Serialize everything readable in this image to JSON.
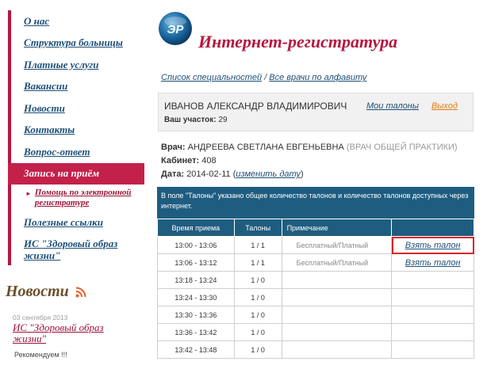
{
  "sidebar": {
    "items": [
      {
        "label": "О нас"
      },
      {
        "label": "Структура больницы"
      },
      {
        "label": "Платные услуги"
      },
      {
        "label": "Вакансии"
      },
      {
        "label": "Новости"
      },
      {
        "label": "Контакты"
      },
      {
        "label": "Вопрос-ответ"
      },
      {
        "label": "Запись на приём"
      }
    ],
    "subitem": "Помощь по электронной регистратуре",
    "after": [
      {
        "label": "Полезные ссылки"
      },
      {
        "label": "ИС \"Здоровый образ жизни\""
      }
    ],
    "accent_color": "#c4214a"
  },
  "news": {
    "title": "Новости",
    "date": "03 сентября 2013",
    "link": "ИС \"Здоровый образ жизни\"",
    "text": "Рекомендуем !!!"
  },
  "header": {
    "logo_text": "ЭР",
    "title": "Интернет-регистратура"
  },
  "breadcrumb": {
    "link1": "Список специальностей",
    "separator": " / ",
    "link2": "Все врачи по алфавиту"
  },
  "user": {
    "name": "ИВАНОВ АЛЕКСАНДР ВЛАДИМИРОВИЧ",
    "section_label": "Ваш участок:",
    "section_value": "29",
    "my_tickets": "Мои талоны",
    "logout": "Выход"
  },
  "doctor": {
    "label": "Врач:",
    "name": "АНДРЕЕВА СВЕТЛАНА ЕВГЕНЬЕВНА",
    "specialty": "(ВРАЧ ОБЩЕЙ ПРАКТИКИ)",
    "room_label": "Кабинет:",
    "room": "408",
    "date_label": "Дата:",
    "date": "2014-02-11",
    "change_date": "изменить дату"
  },
  "table": {
    "notice": "В поле \"Талоны\" указано общее количество талонов и количество талонов доступных через интернет.",
    "headers": [
      "Время приема",
      "Талоны",
      "Примечание",
      ""
    ],
    "rows": [
      {
        "time": "13:00 - 13:06",
        "tickets": "1 / 1",
        "note": "Бесплатный/Платный",
        "action": "Взять талон"
      },
      {
        "time": "13:06 - 13:12",
        "tickets": "1 / 1",
        "note": "Бесплатный/Платный",
        "action": "Взять талон"
      },
      {
        "time": "13:18 - 13:24",
        "tickets": "1 / 0",
        "note": "",
        "action": ""
      },
      {
        "time": "13:24 - 13:30",
        "tickets": "1 / 0",
        "note": "",
        "action": ""
      },
      {
        "time": "13:30 - 13:36",
        "tickets": "1 / 0",
        "note": "",
        "action": ""
      },
      {
        "time": "13:36 - 13:42",
        "tickets": "1 / 0",
        "note": "",
        "action": ""
      },
      {
        "time": "13:42 - 13:48",
        "tickets": "1 / 0",
        "note": "",
        "action": ""
      }
    ],
    "header_color": "#1f5d80"
  }
}
